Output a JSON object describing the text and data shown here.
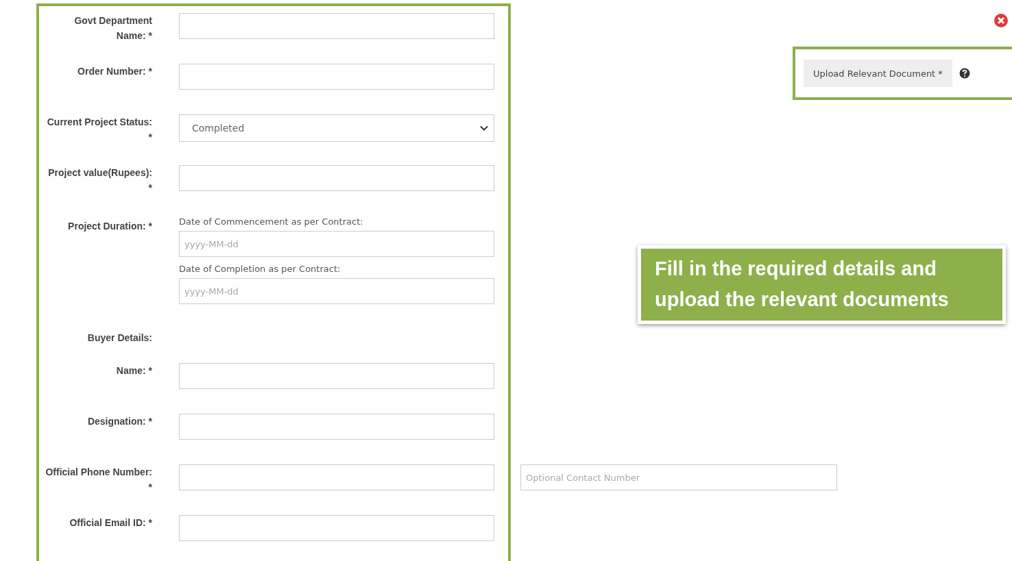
{
  "form": {
    "rows": [
      {
        "kind": "text",
        "label": "Govt Department Name: *"
      },
      {
        "kind": "text",
        "label": "Order Number: *"
      },
      {
        "kind": "select",
        "label": "Current Project Status: *",
        "value": "Completed"
      },
      {
        "kind": "text",
        "label": "Project value(Rupees): *"
      },
      {
        "kind": "dates",
        "label": "Project Duration: *",
        "dates": [
          {
            "caption": "Date of Commencement as per Contract:",
            "placeholder": "yyyy-MM-dd"
          },
          {
            "caption": "Date of Completion as per Contract:",
            "placeholder": "yyyy-MM-dd"
          }
        ]
      },
      {
        "kind": "heading",
        "label": "Buyer Details:"
      },
      {
        "kind": "text",
        "label": "Name: *"
      },
      {
        "kind": "text",
        "label": "Designation: *"
      },
      {
        "kind": "text",
        "label": "Official Phone Number: *",
        "extra_placeholder": "Optional Contact Number"
      },
      {
        "kind": "text",
        "label": "Official Email ID: *"
      }
    ]
  },
  "upload": {
    "button": "Upload Relevant Document *"
  },
  "callout": {
    "text": "Fill in the required details and upload the relevant documents"
  }
}
